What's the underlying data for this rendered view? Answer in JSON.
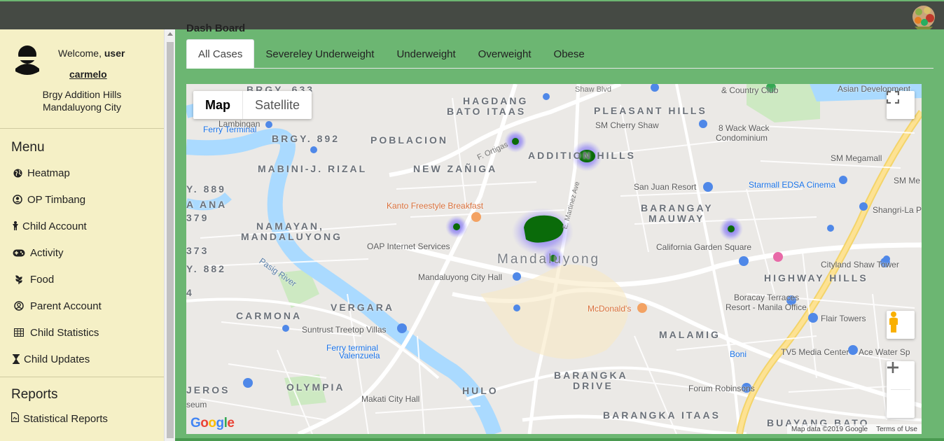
{
  "sidebar": {
    "welcome_prefix": "Welcome,",
    "welcome_user": "user",
    "username": "carmelo",
    "barangay_line1": "Brgy Addition Hills",
    "barangay_line2": "Mandaluyong City",
    "menu_title": "Menu",
    "items": [
      {
        "label": "Heatmap",
        "icon": "globe-icon"
      },
      {
        "label": "OP Timbang",
        "icon": "user-circle-icon"
      },
      {
        "label": "Child Account",
        "icon": "child-icon"
      },
      {
        "label": "Activity",
        "icon": "gamepad-icon"
      },
      {
        "label": "Food",
        "icon": "seedling-icon"
      },
      {
        "label": "Parent Account",
        "icon": "user-circle-outline-icon"
      },
      {
        "label": "Child Statistics",
        "icon": "table-icon"
      },
      {
        "label": "Child Updates",
        "icon": "hourglass-icon"
      }
    ],
    "reports_title": "Reports",
    "reports": [
      {
        "label": "Statistical Reports",
        "icon": "file-pdf-icon"
      }
    ]
  },
  "main": {
    "dash_label": "Dash Board",
    "tabs": [
      {
        "label": "All Cases",
        "active": true
      },
      {
        "label": "Severeley Underweight",
        "active": false
      },
      {
        "label": "Underweight",
        "active": false
      },
      {
        "label": "Overweight",
        "active": false
      },
      {
        "label": "Obese",
        "active": false
      }
    ]
  },
  "map": {
    "type_map": "Map",
    "type_satellite": "Satellite",
    "google": "Google",
    "attribution": "Map data ©2019 Google",
    "terms": "Terms of Use",
    "areas": {
      "hagdang": "HAGDANG",
      "bato_itaas": "BATO ITAAS",
      "pleasant_hills": "PLEASANT HILLS",
      "brgy_892": "BRGY. 892",
      "poblacion": "POBLACION",
      "addition_hills": "ADDITION HILLS",
      "mabini": "MABINI-J. RIZAL",
      "new_zaniga": "NEW ZAÑIGA",
      "brgy_889": "Y. 889",
      "ana": "A ANA",
      "n379": "379",
      "barangay": "BARANGAY",
      "mauway": "MAUWAY",
      "namayan": "NAMAYAN,",
      "namayan2": "MANDALUYONG",
      "n373": "373",
      "mandaluyong": "Mandaluyong",
      "n882": "Y. 882",
      "highway_hills": "HIGHWAY HILLS",
      "n4": "4",
      "vergara": "VERGARA",
      "carmona": "CARMONA",
      "malamig": "MALAMIG",
      "olympia": "OLYMPIA",
      "hulo": "HULO",
      "barangka_drive": "BARANGKA",
      "barangka_drive2": "DRIVE",
      "barangka_itaas": "BARANGKA ITAAS",
      "buayang_bato": "BUAYANG BATO",
      "jeros": "JEROS",
      "brgy_633": "BRGY. 633"
    },
    "pois": {
      "lambingan": "Lambingan",
      "ferry": "Ferry Terminal",
      "country_club": "& Country Club",
      "asian_dev": "Asian Development",
      "sm_cherry": "SM Cherry Shaw",
      "wack": "8 Wack Wack",
      "condo": "Condominium",
      "sm_megamall": "SM Megamall",
      "sm_me": "SM Me",
      "san_juan": "San Juan Resort",
      "starmall": "Starmall EDSA Cinema",
      "shangri": "Shangri-La P",
      "kanto": "Kanto Freestyle Breakfast",
      "oap": "OAP Internet Services",
      "california": "California Garden Square",
      "cityland": "Cityland Shaw Tower",
      "city_hall": "Mandaluyong City Hall",
      "boracay": "Boracay Terraces",
      "resort_manila": "Resort - Manila Office",
      "mcdonalds": "McDonald's",
      "flair": "Flair Towers",
      "suntrust": "Suntrust Treetop Villas",
      "ferry_val": "Ferry terminal",
      "valenzuela": "Valenzuela",
      "tv5": "TV5 Media Center",
      "ace": "Ace Water Sp",
      "boni": "Boni",
      "forum": "Forum Robinsons",
      "makati_hall": "Makati City Hall",
      "seum": "seum",
      "pasig": "Pasig River",
      "shaw": "Shaw Blvd",
      "ortigas": "F. Ortigas",
      "martinez": "E. Martinez Ave"
    }
  },
  "heatmap": [
    {
      "place": "Addition Hills",
      "intensity": 0.55
    },
    {
      "place": "F. Ortigas",
      "intensity": 0.35
    },
    {
      "place": "Kanto area",
      "intensity": 0.35
    },
    {
      "place": "Mandaluyong center",
      "intensity": 1.0
    },
    {
      "place": "Mandaluyong south",
      "intensity": 0.35
    },
    {
      "place": "Barangay Mauway",
      "intensity": 0.4
    }
  ],
  "colors": {
    "topbar": "#454a44",
    "page_bg": "#6cb672",
    "sidebar_bg": "#f5f0c6",
    "heat_core": "#0a6b0a",
    "heat_glow": "#6a5cf5"
  }
}
